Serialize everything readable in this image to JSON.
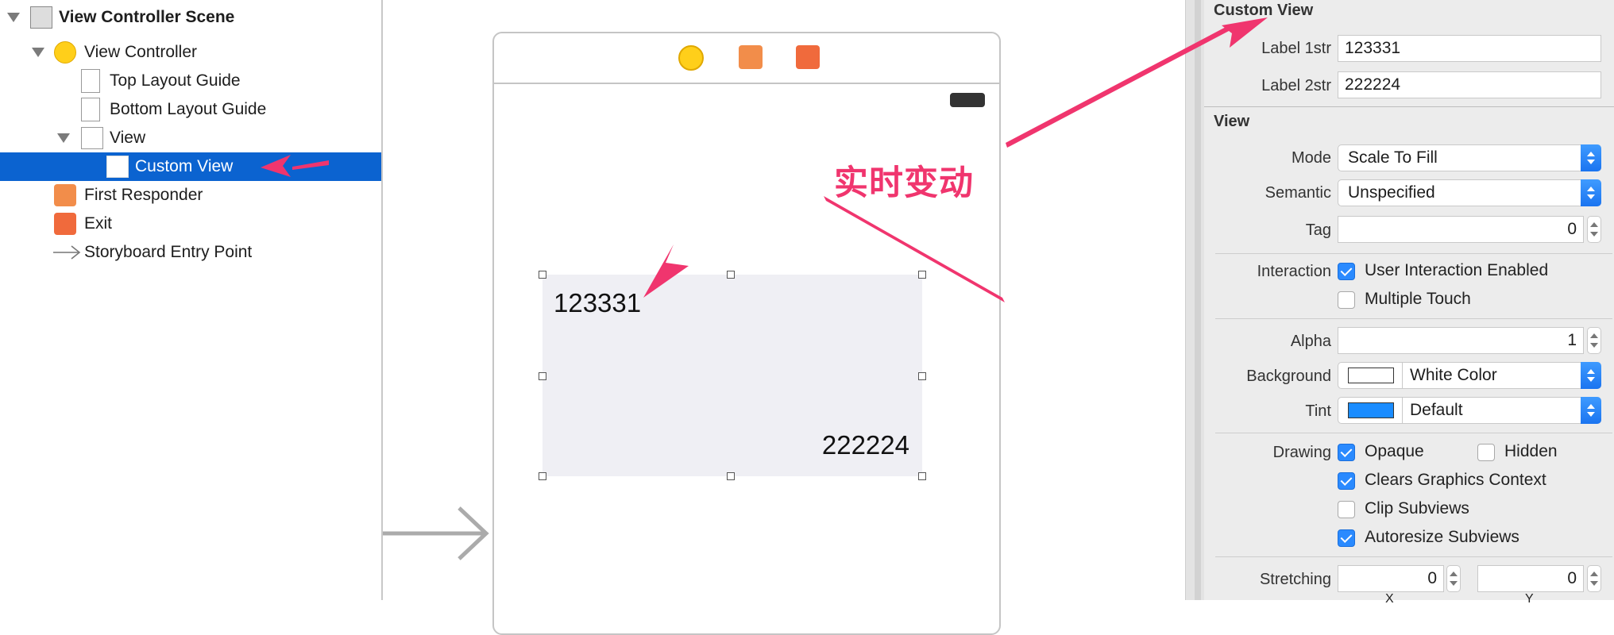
{
  "outline": {
    "scene": "View Controller Scene",
    "view_controller": "View Controller",
    "top_guide": "Top Layout Guide",
    "bottom_guide": "Bottom Layout Guide",
    "view": "View",
    "custom_view": "Custom View",
    "first_responder": "First Responder",
    "exit": "Exit",
    "entry_point": "Storyboard Entry Point"
  },
  "canvas": {
    "label1": "123331",
    "label2": "222224",
    "annotation": "实时变动"
  },
  "inspector": {
    "custom_view": {
      "title": "Custom View",
      "label1_name": "Label 1str",
      "label1_value": "123331",
      "label2_name": "Label 2str",
      "label2_value": "222224"
    },
    "view": {
      "title": "View",
      "mode_label": "Mode",
      "mode_value": "Scale To Fill",
      "semantic_label": "Semantic",
      "semantic_value": "Unspecified",
      "tag_label": "Tag",
      "tag_value": "0",
      "interaction_label": "Interaction",
      "user_interaction": "User Interaction Enabled",
      "multiple_touch": "Multiple Touch",
      "alpha_label": "Alpha",
      "alpha_value": "1",
      "background_label": "Background",
      "background_value": "White Color",
      "tint_label": "Tint",
      "tint_value": "Default",
      "drawing_label": "Drawing",
      "opaque": "Opaque",
      "hidden": "Hidden",
      "clears_graphics": "Clears Graphics Context",
      "clip_subviews": "Clip Subviews",
      "autoresize": "Autoresize Subviews",
      "stretching_label": "Stretching",
      "stretch_x": "0",
      "stretch_y": "0",
      "x_caption": "X",
      "y_caption": "Y"
    },
    "checks": {
      "user_interaction": true,
      "multiple_touch": false,
      "opaque": true,
      "hidden": false,
      "clears_graphics": true,
      "clip_subviews": false,
      "autoresize": true
    }
  },
  "colors": {
    "selection": "#0b63d0",
    "annotation": "#f0356e",
    "tint_swatch": "#1a8cff",
    "checkbox": "#2a8aff"
  }
}
